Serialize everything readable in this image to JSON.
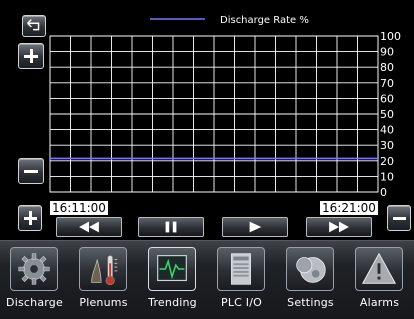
{
  "colors": {
    "grid": "#ffffff",
    "plot_bg": "#000000",
    "series": "#7d73ff",
    "frame": "#b8bcc2"
  },
  "chart_data": {
    "type": "line",
    "series": [
      {
        "name": "Discharge Rate %",
        "values": [
          21.5,
          21.5
        ]
      }
    ],
    "x": [
      "16:11:00",
      "16:21:00"
    ],
    "ylim": [
      0,
      100
    ],
    "y_ticks": [
      "100",
      "90",
      "80",
      "70",
      "60",
      "50",
      "40",
      "30",
      "20",
      "10",
      "0"
    ],
    "grid": true,
    "legend_position": "top-center"
  },
  "time_window": {
    "start": "16:11:00",
    "end": "16:21:00"
  },
  "side_buttons": {
    "top_icon": "back-arrow-icon",
    "zoom_in_left": "plus-icon",
    "zoom_out_left": "minus-icon",
    "zoom_in_bottom": "plus-icon",
    "zoom_out_right": "minus-icon"
  },
  "playback": {
    "rewind_icon": "rewind-icon",
    "pause_icon": "pause-icon",
    "play_icon": "play-icon",
    "fast_forward_icon": "fast-forward-icon"
  },
  "nav": [
    {
      "label": "Discharge",
      "icon": "gear-icon"
    },
    {
      "label": "Plenums",
      "icon": "thermometer-icon"
    },
    {
      "label": "Trending",
      "icon": "monitor-trend-icon"
    },
    {
      "label": "PLC I/O",
      "icon": "plc-device-icon"
    },
    {
      "label": "Settings",
      "icon": "settings-disc-icon"
    },
    {
      "label": "Alarms",
      "icon": "warning-icon"
    }
  ]
}
